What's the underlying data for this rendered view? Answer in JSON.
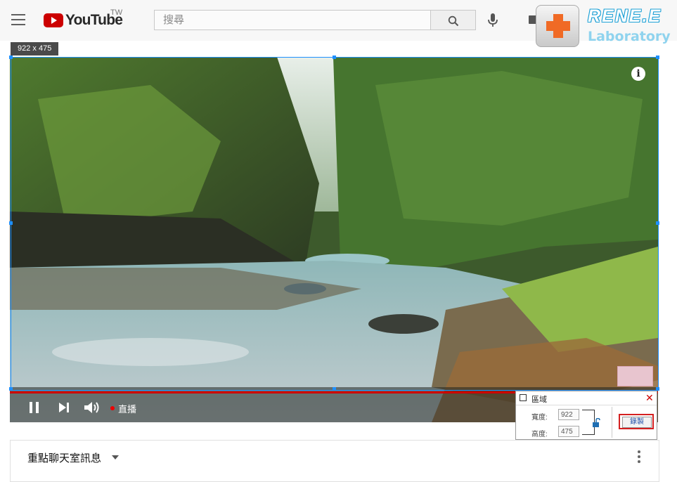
{
  "youtube": {
    "logo_text": "YouTube",
    "region": "TW",
    "search_placeholder": "搜尋"
  },
  "watermark": {
    "title": "RENE.E",
    "subtitle": "Laboratory"
  },
  "selection": {
    "size_label": "922 x 475"
  },
  "player": {
    "info_label": "i",
    "live_label": "直播"
  },
  "region_dialog": {
    "title": "區域",
    "width_label": "寬度:",
    "width_value": "922",
    "height_label": "高度:",
    "height_value": "475",
    "record_label": "錄製"
  },
  "chat": {
    "title": "重點聊天室訊息"
  },
  "colors": {
    "selection_border": "#1e90ff",
    "youtube_red": "#cc0000",
    "record_highlight": "#d42020"
  }
}
